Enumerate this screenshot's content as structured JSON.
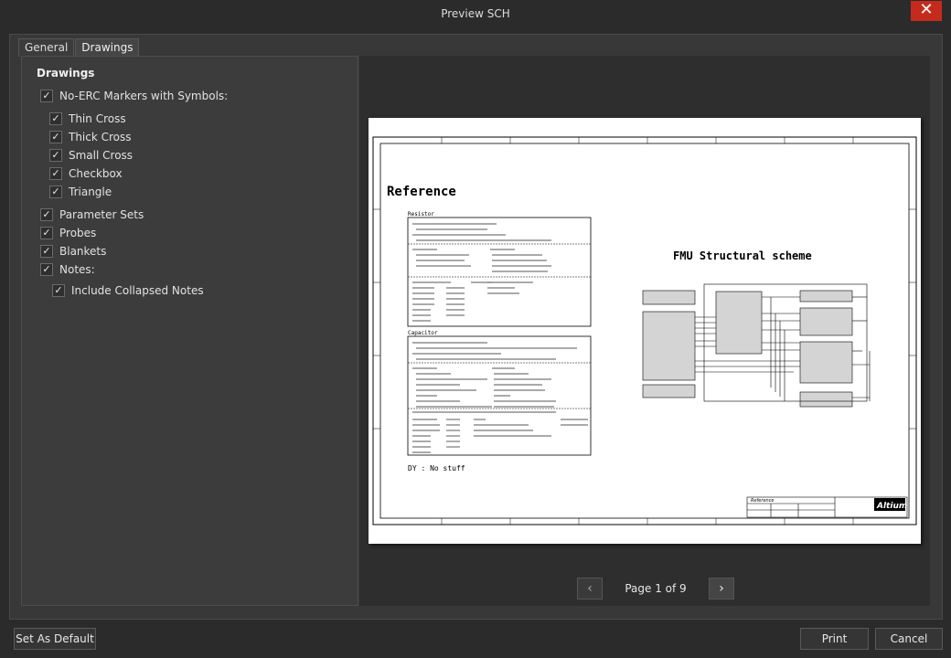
{
  "window": {
    "title": "Preview SCH",
    "close_glyph": "✕"
  },
  "tabs": [
    {
      "label": "General"
    },
    {
      "label": "Drawings"
    }
  ],
  "drawings": {
    "section_title": "Drawings",
    "check_glyph": "✓",
    "no_erc": {
      "label": "No-ERC Markers with Symbols:",
      "checked": true
    },
    "markers": [
      {
        "label": "Thin Cross",
        "checked": true
      },
      {
        "label": "Thick Cross",
        "checked": true
      },
      {
        "label": "Small Cross",
        "checked": true
      },
      {
        "label": "Checkbox",
        "checked": true
      },
      {
        "label": "Triangle",
        "checked": true
      }
    ],
    "parameter_sets": {
      "label": "Parameter Sets",
      "checked": true
    },
    "probes": {
      "label": "Probes",
      "checked": true
    },
    "blankets": {
      "label": "Blankets",
      "checked": true
    },
    "notes": {
      "label": "Notes:",
      "checked": true
    },
    "collapsed_notes": {
      "label": "Include Collapsed Notes",
      "checked": true
    }
  },
  "preview": {
    "reference_title": "Reference",
    "resistor_label": "Resistor",
    "capacitor_label": "Capacitor",
    "dy_text": "DY : No stuff",
    "scheme_title": "FMU Structural scheme",
    "logo_text": "Altium",
    "sheet_title": "Reference"
  },
  "pager": {
    "text": "Page 1 of 9",
    "prev_icon": "‹",
    "next_icon": "›"
  },
  "buttons": {
    "set_default": "Set As Default",
    "print": "Print",
    "cancel": "Cancel"
  }
}
